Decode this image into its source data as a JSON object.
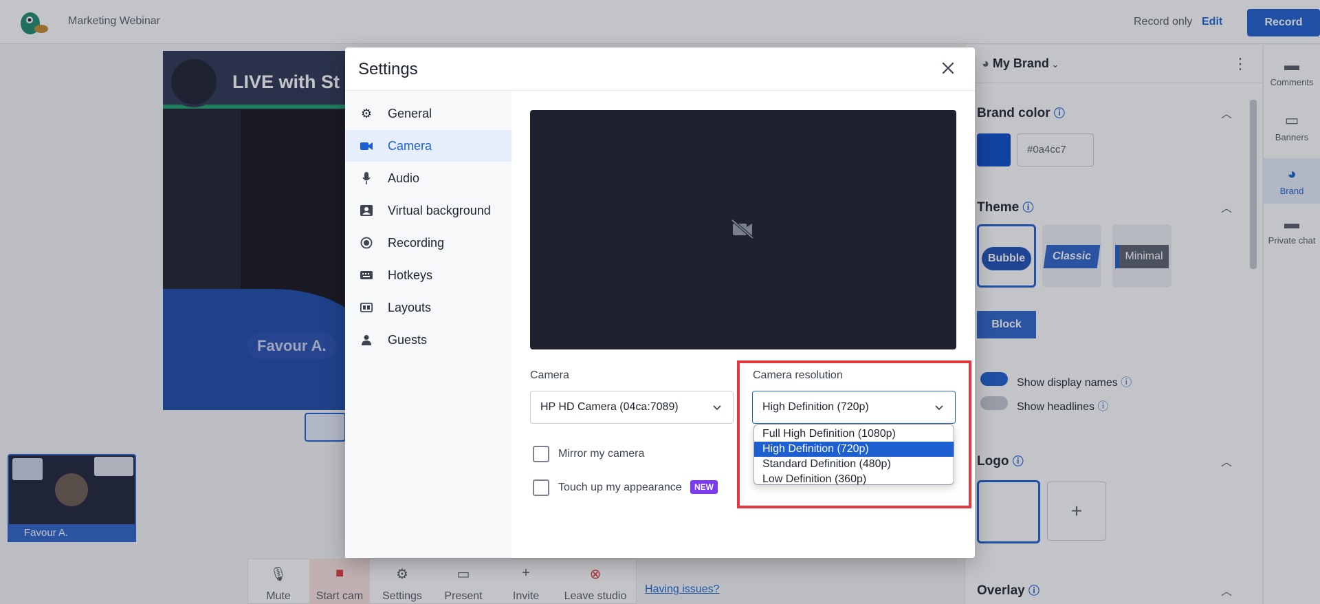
{
  "app": {
    "title": "Marketing Webinar",
    "record_only": "Record only",
    "edit": "Edit",
    "record": "Record"
  },
  "stage": {
    "title": "LIVE with St",
    "presenter_name": "Favour A."
  },
  "participant": {
    "name": "Favour A."
  },
  "bottombar": {
    "mute": "Mute",
    "start_cam": "Start cam",
    "settings": "Settings",
    "present": "Present",
    "invite": "Invite",
    "leave": "Leave studio",
    "issues": "Having issues?"
  },
  "brand_panel": {
    "brand_name": "My Brand",
    "brand_color_title": "Brand color",
    "brand_color_hex": "#0a4cc7",
    "theme_title": "Theme",
    "themes": [
      "Bubble",
      "Classic",
      "Minimal",
      "Block"
    ],
    "show_display_names": "Show display names",
    "show_headlines": "Show headlines",
    "logo_title": "Logo",
    "logo_add": "+",
    "overlay_title": "Overlay"
  },
  "rail": {
    "items": [
      "Comments",
      "Banners",
      "Brand",
      "Private chat"
    ]
  },
  "settings": {
    "title": "Settings",
    "nav": [
      "General",
      "Camera",
      "Audio",
      "Virtual background",
      "Recording",
      "Hotkeys",
      "Layouts",
      "Guests"
    ],
    "camera_label": "Camera",
    "camera_value": "HP HD Camera (04ca:7089)",
    "resolution_label": "Camera resolution",
    "resolution_value": "High Definition (720p)",
    "resolution_options": [
      "Full High Definition (1080p)",
      "High Definition (720p)",
      "Standard Definition (480p)",
      "Low Definition (360p)"
    ],
    "mirror_label": "Mirror my camera",
    "touchup_label": "Touch up my appearance",
    "new_badge": "NEW"
  },
  "colors": {
    "accent": "#1d5fd0",
    "highlight": "#e0393e",
    "preview_bg": "#1f2131"
  }
}
